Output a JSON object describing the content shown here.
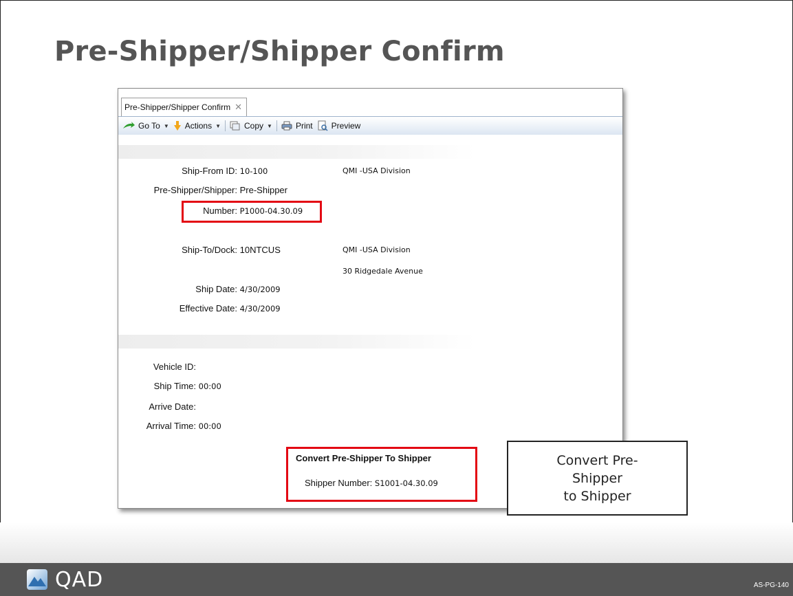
{
  "slide": {
    "title": "Pre-Shipper/Shipper Confirm",
    "logo_text": "QAD",
    "slide_code": "AS-PG-140"
  },
  "window": {
    "tab_label": "Pre-Shipper/Shipper Confirm",
    "toolbar": {
      "goto_label": "Go To",
      "actions_label": "Actions",
      "copy_label": "Copy",
      "print_label": "Print",
      "preview_label": "Preview"
    },
    "header": {
      "ship_from_label": "Ship-From ID:",
      "ship_from_value": "10-100",
      "ship_from_desc": "QMI -USA Division",
      "type_label": "Pre-Shipper/Shipper:",
      "type_value": "Pre-Shipper",
      "number_label": "Number:",
      "number_value": "P1000-04.30.09",
      "ship_to_label": "Ship-To/Dock:",
      "ship_to_value": "10NTCUS",
      "ship_to_desc_1": "QMI -USA Division",
      "ship_to_desc_2": "30 Ridgedale Avenue",
      "ship_date_label": "Ship Date:",
      "ship_date_value": "4/30/2009",
      "effective_date_label": "Effective Date:",
      "effective_date_value": "4/30/2009"
    },
    "details": {
      "vehicle_label": "Vehicle ID:",
      "vehicle_value": "",
      "ship_time_label": "Ship Time:",
      "ship_time_value": "00:00",
      "arrive_date_label": "Arrive Date:",
      "arrive_date_value": "",
      "arrival_time_label": "Arrival Time:",
      "arrival_time_value": "00:00"
    },
    "convert": {
      "heading": "Convert Pre-Shipper To Shipper",
      "shipper_number_label": "Shipper Number:",
      "shipper_number_value": "S1001-04.30.09"
    }
  },
  "callout": {
    "line1": "Convert Pre-",
    "line2": "Shipper",
    "line3": "to Shipper"
  },
  "colors": {
    "highlight": "#e30613",
    "footer": "#555555",
    "title": "#555555"
  }
}
